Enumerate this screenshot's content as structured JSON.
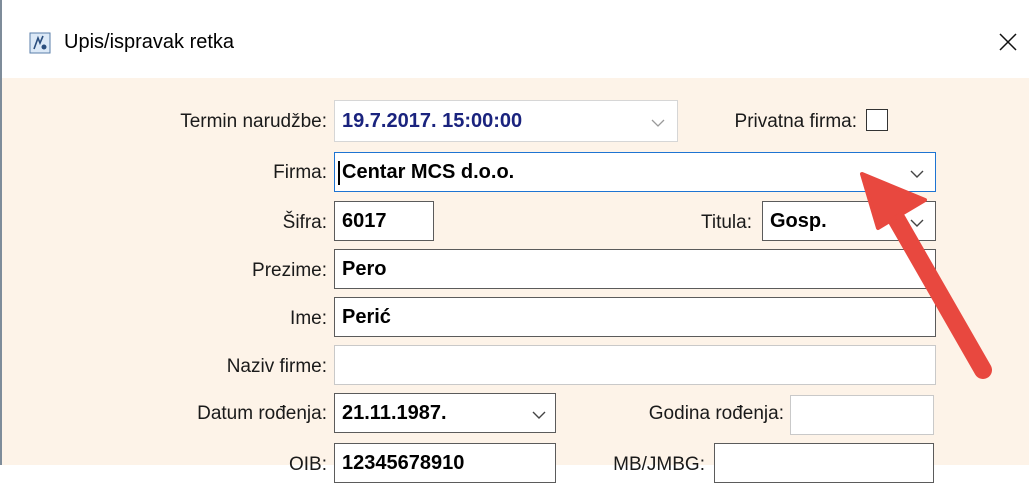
{
  "window": {
    "title": "Upis/ispravak retka",
    "close_glyph": "✕"
  },
  "form": {
    "termin": {
      "label": "Termin narudžbe:",
      "value": "19.7.2017. 15:00:00"
    },
    "privatna_firma": {
      "label": "Privatna firma:",
      "checked": false
    },
    "firma": {
      "label": "Firma:",
      "value": "Centar MCS d.o.o."
    },
    "sifra": {
      "label": "Šifra:",
      "value": "6017"
    },
    "titula": {
      "label": "Titula:",
      "value": "Gosp."
    },
    "prezime": {
      "label": "Prezime:",
      "value": "Pero"
    },
    "ime": {
      "label": "Ime:",
      "value": "Perić"
    },
    "naziv_firme": {
      "label": "Naziv firme:",
      "value": ""
    },
    "datum_rodjenja": {
      "label": "Datum rođenja:",
      "value": "21.11.1987."
    },
    "godina_rodjenja": {
      "label": "Godina rođenja:",
      "value": ""
    },
    "oib": {
      "label": "OIB:",
      "value": "12345678910"
    },
    "mb_jmbg": {
      "label": "MB/JMBG:",
      "value": ""
    }
  },
  "colors": {
    "datetime_text": "#1a237e",
    "focus_border": "#1e74d2",
    "form_bg": "#fdf3e8",
    "arrow": "#e8483f"
  },
  "icons": {
    "app": "document-edit-icon",
    "close": "close-icon",
    "annotation": "red-arrow"
  }
}
